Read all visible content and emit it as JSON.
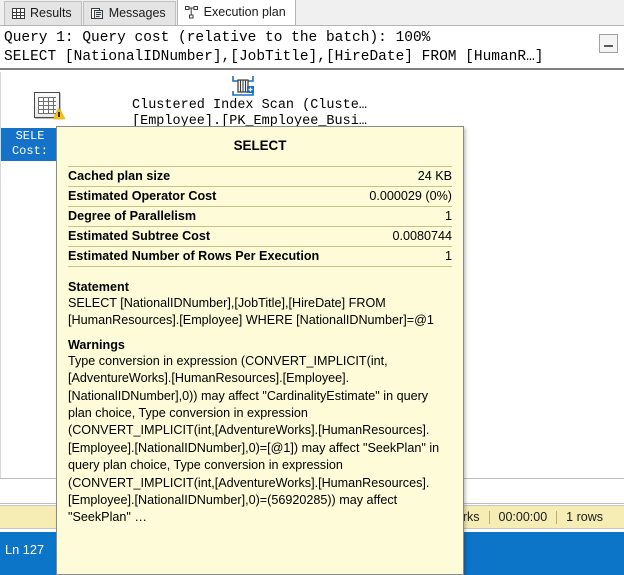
{
  "tabs": [
    {
      "label": "Results",
      "icon": "grid-icon",
      "active": false
    },
    {
      "label": "Messages",
      "icon": "message-icon",
      "active": false
    },
    {
      "label": "Execution plan",
      "icon": "execution-plan-icon",
      "active": true
    }
  ],
  "query_header": {
    "cost_line": "Query 1: Query cost (relative to the batch): 100%",
    "statement_line": "SELECT [NationalIDNumber],[JobTitle],[HireDate] FROM [HumanR…]",
    "collapse_button_label": "−"
  },
  "plan": {
    "clustered_index_scan": {
      "line1": "Clustered Index Scan (Cluste…",
      "line2": "[Employee].[PK_Employee_Busi…",
      "icon": "clustered-index-scan-icon"
    },
    "select_node": {
      "icon": "select-operator-icon",
      "warning_icon": "warning-triangle-icon",
      "caption_line1": "SELE",
      "caption_line2": "Cost:"
    }
  },
  "tooltip": {
    "title": "SELECT",
    "properties": [
      {
        "key": "Cached plan size",
        "value": "24 KB"
      },
      {
        "key": "Estimated Operator Cost",
        "value": "0.000029 (0%)"
      },
      {
        "key": "Degree of Parallelism",
        "value": "1"
      },
      {
        "key": "Estimated Subtree Cost",
        "value": "0.0080744"
      },
      {
        "key": "Estimated Number of Rows Per Execution",
        "value": "1"
      }
    ],
    "statement_heading": "Statement",
    "statement_text": "SELECT [NationalIDNumber],[JobTitle],[HireDate] FROM [HumanResources].[Employee] WHERE [NationalIDNumber]=@1",
    "warnings_heading": "Warnings",
    "warnings_text": "Type conversion in expression (CONVERT_IMPLICIT(int,[AdventureWorks].[HumanResources].[Employee].[NationalIDNumber],0)) may affect \"CardinalityEstimate\" in query plan choice, Type conversion in expression (CONVERT_IMPLICIT(int,[AdventureWorks].[HumanResources].[Employee].[NationalIDNumber],0)=[@1]) may affect \"SeekPlan\" in query plan choice, Type conversion in expression (CONVERT_IMPLICIT(int,[AdventureWorks].[HumanResources].[Employee].[NationalIDNumber],0)=(56920285)) may affect \"SeekPlan\" …"
  },
  "status_bar": {
    "database": "orks",
    "elapsed_time": "00:00:00",
    "row_count": "1 rows"
  },
  "editor_status": {
    "line_indicator": "Ln 127"
  },
  "colors": {
    "accent_blue": "#0d75c8",
    "tooltip_bg": "#fdfbd8",
    "status_bg": "#f5edb4",
    "warning_yellow": "#f6c000"
  }
}
